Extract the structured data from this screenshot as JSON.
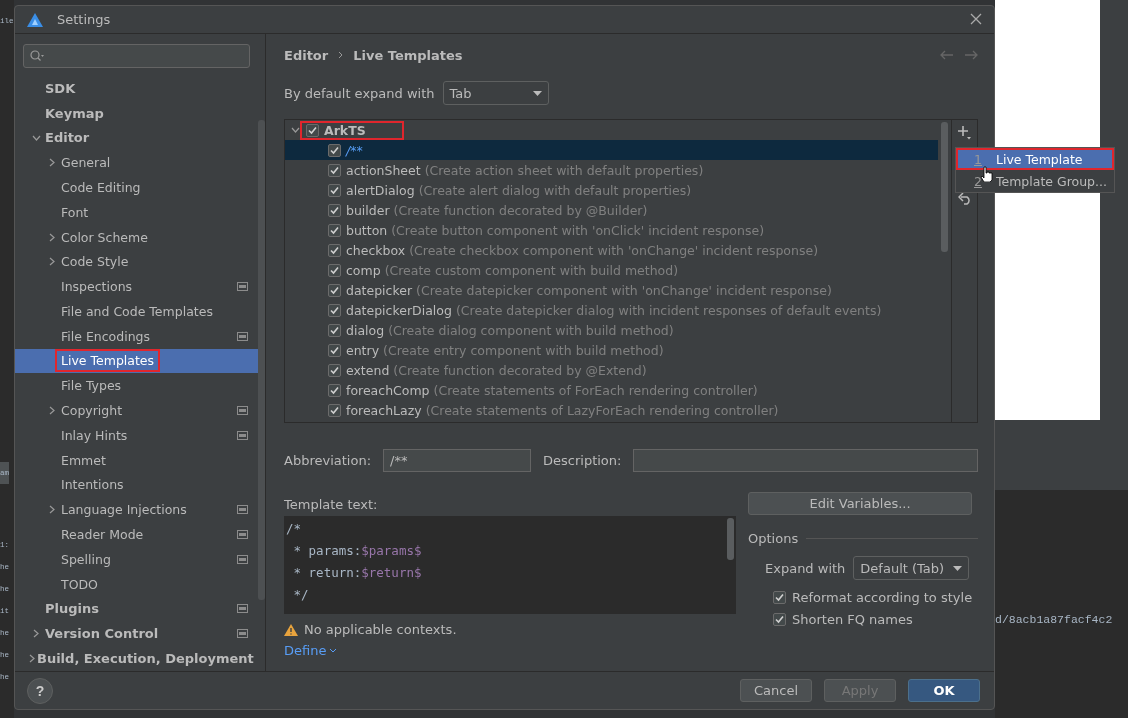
{
  "background": {
    "left_fragments": [
      "ile",
      "am",
      "1:",
      "he",
      "he",
      "it",
      "he",
      "he",
      "he"
    ],
    "terminal_text": "d/8acb1a87facf4c2"
  },
  "window": {
    "title": "Settings"
  },
  "sidebar": {
    "items": [
      {
        "label": "SDK",
        "selected": false,
        "badge": false,
        "highlighted": false
      },
      {
        "label": "Keymap",
        "selected": false,
        "badge": false,
        "highlighted": false
      },
      {
        "label": "Editor",
        "selected": false,
        "badge": false,
        "highlighted": false,
        "expanded": true,
        "children": [
          {
            "label": "General",
            "selected": false,
            "badge": false,
            "highlighted": false,
            "expanded": false
          },
          {
            "label": "Code Editing",
            "selected": false,
            "badge": false,
            "highlighted": false
          },
          {
            "label": "Font",
            "selected": false,
            "badge": false,
            "highlighted": false
          },
          {
            "label": "Color Scheme",
            "selected": false,
            "badge": false,
            "highlighted": false,
            "expanded": false
          },
          {
            "label": "Code Style",
            "selected": false,
            "badge": false,
            "highlighted": false,
            "expanded": false
          },
          {
            "label": "Inspections",
            "selected": false,
            "badge": true,
            "highlighted": false
          },
          {
            "label": "File and Code Templates",
            "selected": false,
            "badge": false,
            "highlighted": false
          },
          {
            "label": "File Encodings",
            "selected": false,
            "badge": true,
            "highlighted": false
          },
          {
            "label": "Live Templates",
            "selected": true,
            "badge": false,
            "highlighted": true
          },
          {
            "label": "File Types",
            "selected": false,
            "badge": false,
            "highlighted": false
          },
          {
            "label": "Copyright",
            "selected": false,
            "badge": true,
            "highlighted": false,
            "expanded": false
          },
          {
            "label": "Inlay Hints",
            "selected": false,
            "badge": true,
            "highlighted": false
          },
          {
            "label": "Emmet",
            "selected": false,
            "badge": false,
            "highlighted": false
          },
          {
            "label": "Intentions",
            "selected": false,
            "badge": false,
            "highlighted": false
          },
          {
            "label": "Language Injections",
            "selected": false,
            "badge": true,
            "highlighted": false,
            "expanded": false
          },
          {
            "label": "Reader Mode",
            "selected": false,
            "badge": true,
            "highlighted": false
          },
          {
            "label": "Spelling",
            "selected": false,
            "badge": true,
            "highlighted": false
          },
          {
            "label": "TODO",
            "selected": false,
            "badge": false,
            "highlighted": false
          }
        ]
      },
      {
        "label": "Plugins",
        "selected": false,
        "badge": true,
        "highlighted": false
      },
      {
        "label": "Version Control",
        "selected": false,
        "badge": true,
        "highlighted": false,
        "expanded": false
      },
      {
        "label": "Build, Execution, Deployment",
        "selected": false,
        "badge": false,
        "highlighted": false,
        "expanded": false
      }
    ]
  },
  "breadcrumb": [
    "Editor",
    "Live Templates"
  ],
  "expand_default": {
    "label": "By default expand with",
    "value": "Tab"
  },
  "template_tree": {
    "groups": [
      {
        "name": "ArkTS",
        "checked": true,
        "expanded": true,
        "highlighted": true,
        "children": [
          {
            "name": "/**",
            "checked": true,
            "selected": true
          },
          {
            "name": "actionSheet",
            "description": "(Create action sheet with default properties)",
            "checked": true,
            "selected": false
          },
          {
            "name": "alertDialog",
            "description": "(Create alert dialog with default properties)",
            "checked": true,
            "selected": false
          },
          {
            "name": "builder",
            "description": "(Create function decorated by @Builder)",
            "checked": true,
            "selected": false
          },
          {
            "name": "button",
            "description": "(Create button component with 'onClick' incident response)",
            "checked": true,
            "selected": false
          },
          {
            "name": "checkbox",
            "description": "(Create checkbox component with 'onChange' incident response)",
            "checked": true,
            "selected": false
          },
          {
            "name": "comp",
            "description": "(Create custom component with build method)",
            "checked": true,
            "selected": false
          },
          {
            "name": "datepicker",
            "description": "(Create datepicker component with 'onChange' incident response)",
            "checked": true,
            "selected": false
          },
          {
            "name": "datepickerDialog",
            "description": "(Create datepicker dialog with incident responses of default events)",
            "checked": true,
            "selected": false
          },
          {
            "name": "dialog",
            "description": "(Create dialog component with build method)",
            "checked": true,
            "selected": false
          },
          {
            "name": "entry",
            "description": "(Create entry component with build method)",
            "checked": true,
            "selected": false
          },
          {
            "name": "extend",
            "description": "(Create function decorated by @Extend)",
            "checked": true,
            "selected": false
          },
          {
            "name": "foreachComp",
            "description": "(Create statements of ForEach rendering controller)",
            "checked": true,
            "selected": false
          },
          {
            "name": "foreachLazy",
            "description": "(Create statements of LazyForEach rendering controller)",
            "checked": true,
            "selected": false
          }
        ]
      }
    ]
  },
  "add_menu": {
    "items": [
      {
        "number": "1",
        "label": "Live Template",
        "selected": true,
        "highlighted": true
      },
      {
        "number": "2",
        "label": "Template Group...",
        "selected": false,
        "highlighted": false
      }
    ]
  },
  "abbreviation": {
    "label": "Abbreviation:",
    "value": "/**"
  },
  "description": {
    "label": "Description:"
  },
  "template_text": {
    "label": "Template text:",
    "lines": [
      [
        {
          "kind": "text",
          "text": "/*"
        }
      ],
      [
        {
          "kind": "text",
          "text": " * params:"
        },
        {
          "kind": "variable",
          "text": "$params$"
        }
      ],
      [
        {
          "kind": "text",
          "text": " * return:"
        },
        {
          "kind": "variable",
          "text": "$return$"
        }
      ],
      [
        {
          "kind": "text",
          "text": " */"
        }
      ]
    ]
  },
  "edit_variables_button": "Edit Variables...",
  "options": {
    "title": "Options",
    "expand_with": {
      "label": "Expand with",
      "value": "Default (Tab)"
    },
    "checkboxes": [
      {
        "label": "Reformat according to style",
        "checked": true
      },
      {
        "label": "Shorten FQ names",
        "checked": true
      }
    ]
  },
  "warning": "No applicable contexts.",
  "define_link": "Define",
  "help_button": "?",
  "buttons": [
    {
      "label": "Cancel",
      "kind": "normal"
    },
    {
      "label": "Apply",
      "kind": "disabled"
    },
    {
      "label": "OK",
      "kind": "primary"
    }
  ]
}
